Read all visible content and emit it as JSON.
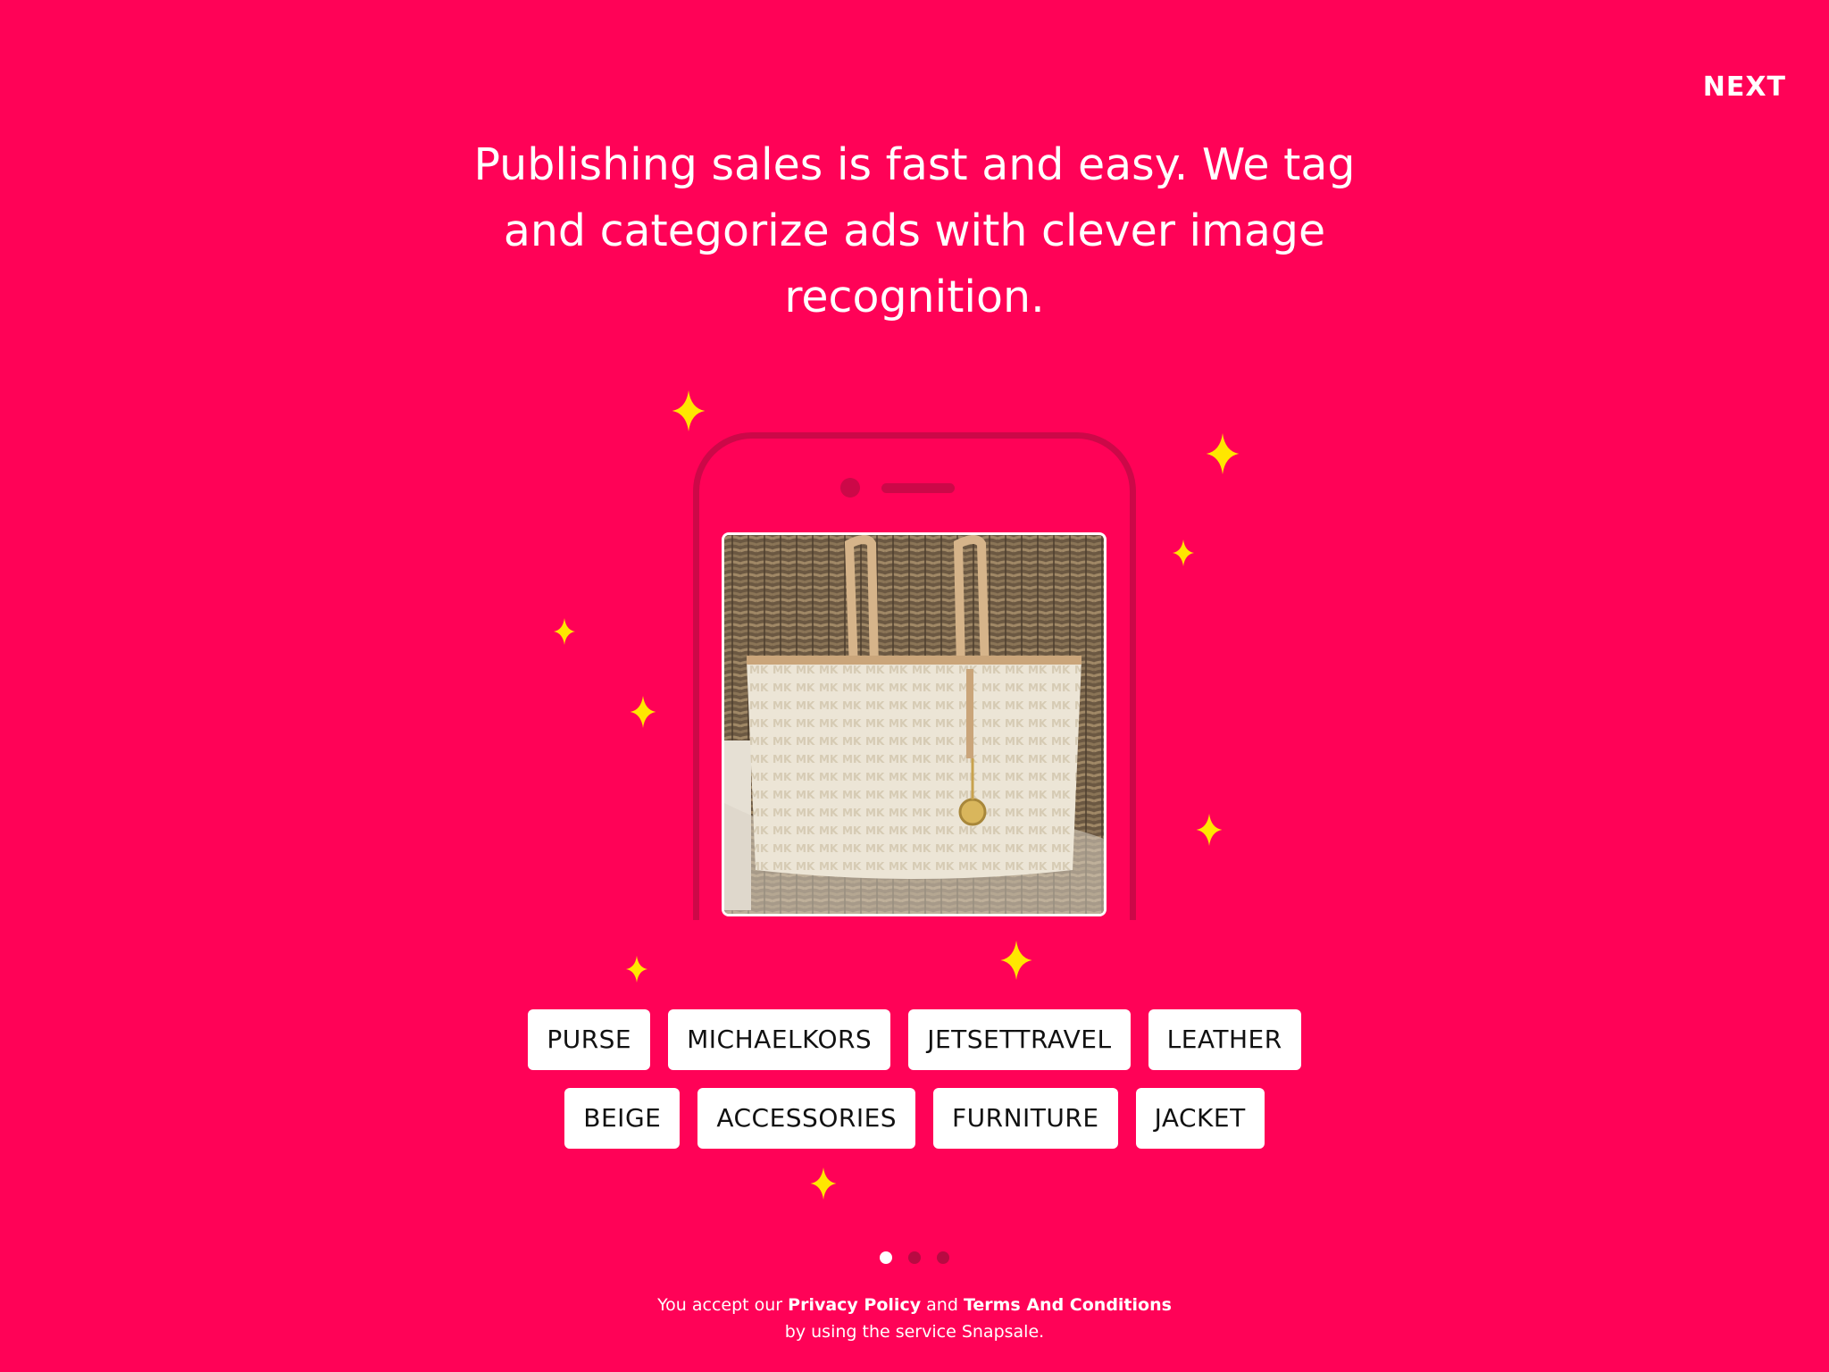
{
  "header": {
    "next_label": "NEXT"
  },
  "headline": {
    "line1": "Publishing sales is fast and easy. We tag",
    "line2": "and categorize ads with clever image",
    "line3": "recognition."
  },
  "tags": {
    "row1": [
      "PURSE",
      "MICHAELKORS",
      "JETSETTRAVEL",
      "LEATHER"
    ],
    "row2": [
      "BEIGE",
      "ACCESSORIES",
      "FURNITURE",
      "JACKET"
    ]
  },
  "pager": {
    "total": 3,
    "active": 1
  },
  "footer": {
    "prefix": "You accept our",
    "privacy_link": "Privacy Policy",
    "and_text": "and",
    "terms_link": "Terms And Conditions",
    "line2": "by using the service Snapsale."
  },
  "colors": {
    "background": "#ff0257",
    "phone_outline": "#cc0848",
    "sparkle": "#ffe600",
    "tag_background": "#ffffff",
    "dot_inactive": "#b80a42",
    "dot_active": "#ffffff"
  },
  "icons": {
    "sparkle": "sparkle-icon"
  }
}
